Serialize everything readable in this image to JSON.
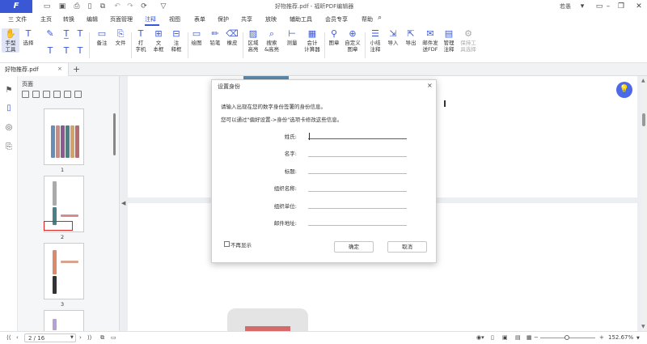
{
  "app": {
    "logo": "F",
    "doc_title": "好物推荐.pdf - 福昕PDF编辑器",
    "user": "若愚"
  },
  "menu": {
    "file_label": "三 文件",
    "items": [
      "主页",
      "转换",
      "编辑",
      "页面管理",
      "注释",
      "视图",
      "表单",
      "保护",
      "共享",
      "放映",
      "辅助工具",
      "会员专享",
      "帮助"
    ]
  },
  "toolbar": {
    "tools": [
      {
        "label": "手型\n工具",
        "icon": "hand-icon"
      },
      {
        "label": "选择",
        "icon": "select-text-icon"
      },
      {
        "label": "备注",
        "icon": "note-icon"
      },
      {
        "label": "文件",
        "icon": "file-attach-icon"
      },
      {
        "label": "打\n字机",
        "icon": "typewriter-icon"
      },
      {
        "label": "文\n本框",
        "icon": "textbox-icon"
      },
      {
        "label": "注\n释框",
        "icon": "callout-icon"
      },
      {
        "label": "绘图",
        "icon": "draw-shape-icon"
      },
      {
        "label": "铅笔",
        "icon": "pencil-icon"
      },
      {
        "label": "橡皮",
        "icon": "eraser-icon"
      },
      {
        "label": "区域\n高亮",
        "icon": "area-highlight-icon"
      },
      {
        "label": "搜索\n&高亮",
        "icon": "search-highlight-icon"
      },
      {
        "label": "测量",
        "icon": "measure-icon"
      },
      {
        "label": "会计\n计算器",
        "icon": "calculator-icon"
      },
      {
        "label": "图章",
        "icon": "stamp-icon"
      },
      {
        "label": "自定义\n图章",
        "icon": "custom-stamp-icon"
      },
      {
        "label": "小结\n注释",
        "icon": "summary-icon"
      },
      {
        "label": "导入",
        "icon": "import-icon"
      },
      {
        "label": "导出",
        "icon": "export-icon"
      },
      {
        "label": "邮件发\n送FDF",
        "icon": "mail-icon"
      },
      {
        "label": "管理\n注释",
        "icon": "manage-icon"
      },
      {
        "label": "保持工\n具选择",
        "icon": "keep-tool-icon"
      }
    ]
  },
  "tab": {
    "label": "好物推荐.pdf",
    "close": "×",
    "add": "+"
  },
  "thumbnails": {
    "title": "页面",
    "pages": [
      "1",
      "2",
      "3"
    ]
  },
  "dialog": {
    "title": "设置身份",
    "close": "×",
    "line1": "请输入出现在您的数字身份签署的身份信息。",
    "line2": "您可以通过\"偏好设置->身份\"选项卡修改这些信息。",
    "fields": [
      {
        "label": "姓氏:",
        "value": ""
      },
      {
        "label": "名字:",
        "value": ""
      },
      {
        "label": "标题:",
        "value": ""
      },
      {
        "label": "组织名称:",
        "value": ""
      },
      {
        "label": "组织单位:",
        "value": ""
      },
      {
        "label": "邮件地址:",
        "value": ""
      }
    ],
    "checkbox_label": "不再显示",
    "ok": "确定",
    "cancel": "取消"
  },
  "status": {
    "page": "2 / 16",
    "zoom": "152.67%"
  },
  "colors": {
    "accent": "#3a57d6",
    "selection_outline": "#e02020"
  }
}
